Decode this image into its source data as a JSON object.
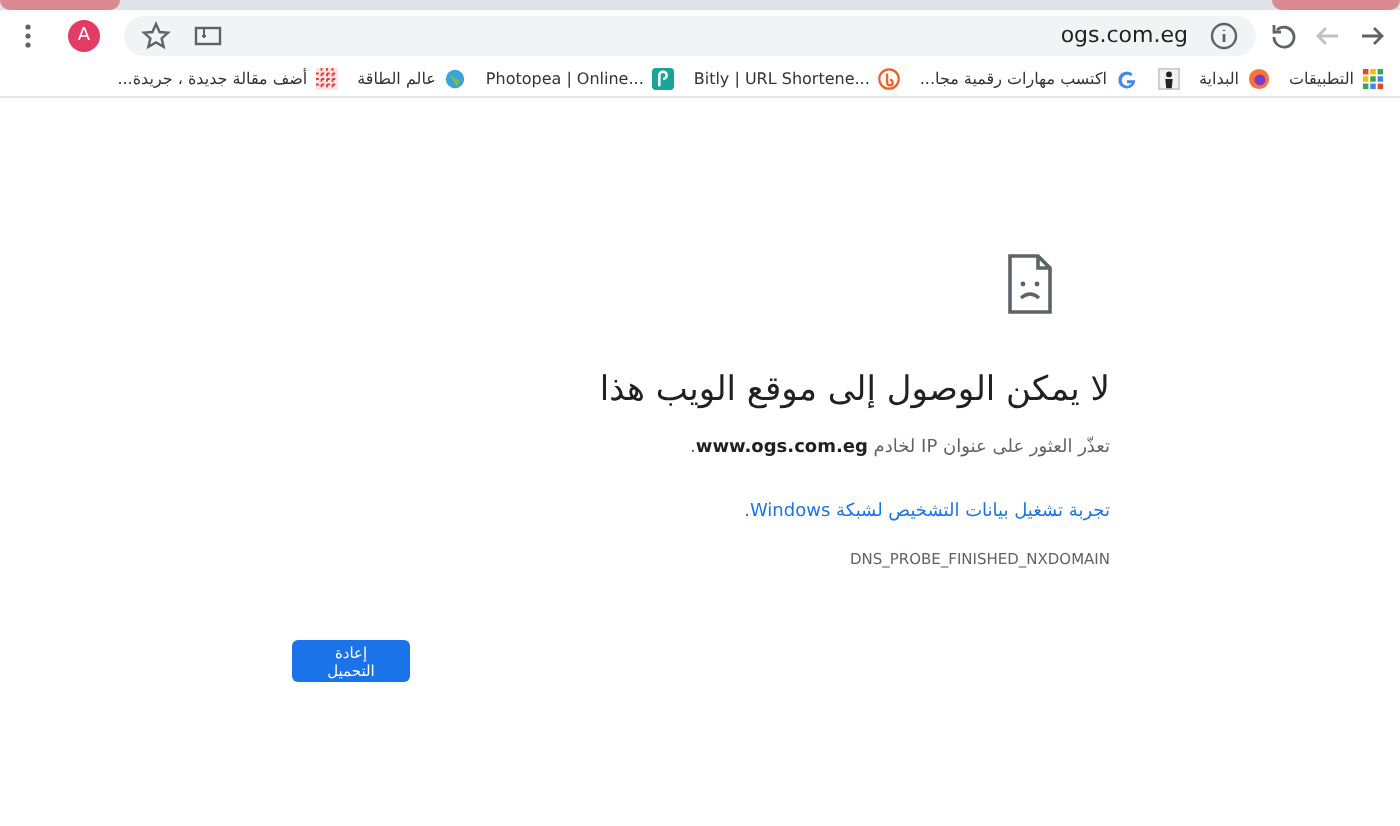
{
  "toolbar": {
    "url": "ogs.com.eg",
    "avatar": "A"
  },
  "bookmarks": [
    {
      "kind": "apps",
      "label": "التطبيقات"
    },
    {
      "kind": "firefox",
      "label": "البداية"
    },
    {
      "kind": "person"
    },
    {
      "kind": "google",
      "label": "اكتسب مهارات رقمية مجا..."
    },
    {
      "kind": "bitly",
      "label": "Bitly | URL Shortene..."
    },
    {
      "kind": "photopea",
      "label": "Photopea | Online..."
    },
    {
      "kind": "globe",
      "label": "عالم الطاقة"
    },
    {
      "kind": "pattern",
      "label": "أضف مقالة جديدة ، جريدة..."
    }
  ],
  "error": {
    "title": "لا يمكن الوصول إلى موقع الويب هذا",
    "message": "تعذّر العثور على عنوان IP لخادم **www.ogs.com.eg**.",
    "link": "تجربة تشغيل بيانات التشخيص لشبكة Windows.",
    "code": "DNS_PROBE_FINISHED_NXDOMAIN"
  },
  "reload_button": {
    "label": "إعادة التحميل"
  }
}
